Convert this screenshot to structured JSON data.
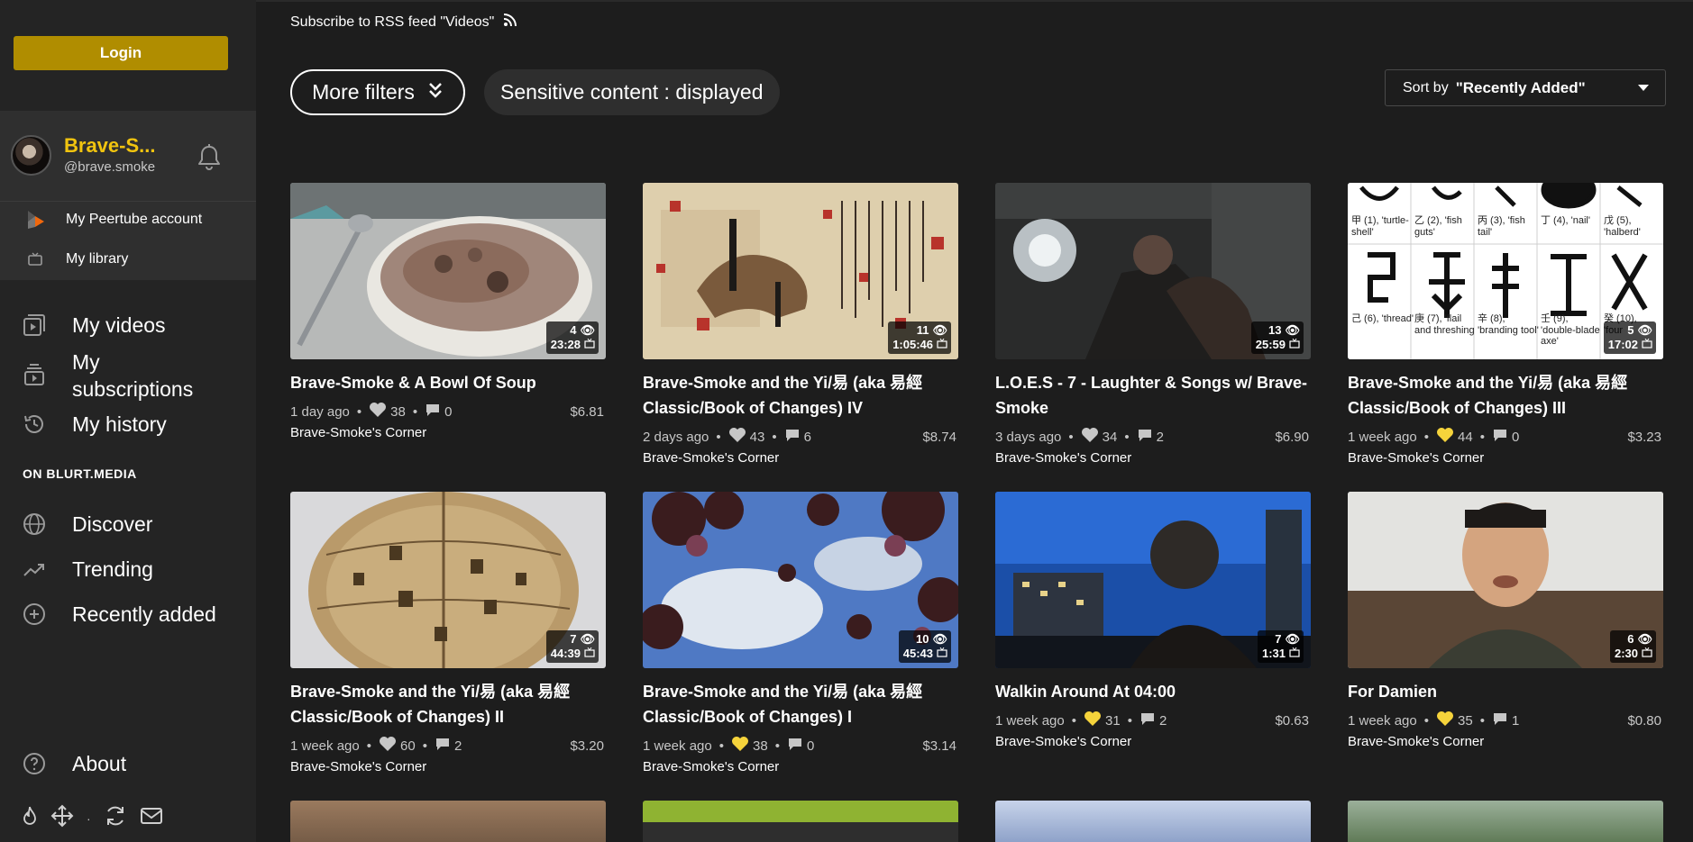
{
  "sidebar": {
    "login_label": "Login",
    "user": {
      "name": "Brave-S...",
      "handle": "@brave.smoke"
    },
    "account_items": [
      {
        "label": "My Peertube account",
        "icon": "peertube-icon"
      },
      {
        "label": "My library",
        "icon": "tv-icon"
      }
    ],
    "library_items": [
      {
        "label": "My videos",
        "icon": "video-library-icon"
      },
      {
        "label": "My\nsubscriptions",
        "icon": "subscriptions-icon"
      },
      {
        "label": "My history",
        "icon": "history-icon"
      }
    ],
    "section_title": "ON BLURT.MEDIA",
    "discover_items": [
      {
        "label": "Discover",
        "icon": "globe-icon"
      },
      {
        "label": "Trending",
        "icon": "trending-icon"
      },
      {
        "label": "Recently added",
        "icon": "plus-circle-icon"
      }
    ],
    "about_label": "About",
    "footer_icons": [
      "fire-icon",
      "move-icon",
      "sync-icon",
      "mail-icon"
    ]
  },
  "header": {
    "rss_label": "Subscribe to RSS feed \"Videos\"",
    "more_filters_label": "More filters",
    "sensitive_label": "Sensitive content : displayed",
    "sort_prefix": "Sort by",
    "sort_value": "\"Recently Added\""
  },
  "colors": {
    "accent": "#b08d00",
    "username": "#f1c40f",
    "like_active": "#f5d33b",
    "like_inactive": "#c7c7c7"
  },
  "videos": [
    {
      "title": "Brave-Smoke & A Bowl Of Soup",
      "views": "4",
      "duration": "23:28",
      "age": "1 day ago",
      "likes": "38",
      "liked": false,
      "comments": "0",
      "price": "$6.81",
      "channel": "Brave-Smoke's Corner",
      "thumb": "soup"
    },
    {
      "title": "Brave-Smoke and the Yi/易 (aka 易經 Classic/Book of Changes) IV",
      "views": "11",
      "duration": "1:05:46",
      "age": "2 days ago",
      "likes": "43",
      "liked": false,
      "comments": "6",
      "price": "$8.74",
      "channel": "Brave-Smoke's Corner",
      "thumb": "scroll"
    },
    {
      "title": "L.O.E.S - 7 - Laughter & Songs w/ Brave-Smoke",
      "views": "13",
      "duration": "25:59",
      "age": "3 days ago",
      "likes": "34",
      "liked": false,
      "comments": "2",
      "price": "$6.90",
      "channel": "Brave-Smoke's Corner",
      "thumb": "kitchen"
    },
    {
      "title": "Brave-Smoke and the Yi/易 (aka 易經 Classic/Book of Changes) III",
      "views": "5",
      "duration": "17:02",
      "age": "1 week ago",
      "likes": "44",
      "liked": true,
      "comments": "0",
      "price": "$3.23",
      "channel": "Brave-Smoke's Corner",
      "thumb": "chars"
    },
    {
      "title": "Brave-Smoke and the Yi/易 (aka 易經 Classic/Book of Changes) II",
      "views": "7",
      "duration": "44:39",
      "age": "1 week ago",
      "likes": "60",
      "liked": false,
      "comments": "2",
      "price": "$3.20",
      "channel": "Brave-Smoke's Corner",
      "thumb": "shell"
    },
    {
      "title": "Brave-Smoke and the Yi/易 (aka 易經 Classic/Book of Changes) I",
      "views": "10",
      "duration": "45:43",
      "age": "1 week ago",
      "likes": "38",
      "liked": true,
      "comments": "0",
      "price": "$3.14",
      "channel": "Brave-Smoke's Corner",
      "thumb": "sky"
    },
    {
      "title": "Walkin Around At 04:00",
      "views": "7",
      "duration": "1:31",
      "age": "1 week ago",
      "likes": "31",
      "liked": true,
      "comments": "2",
      "price": "$0.63",
      "channel": "Brave-Smoke's Corner",
      "thumb": "night"
    },
    {
      "title": "For Damien",
      "views": "6",
      "duration": "2:30",
      "age": "1 week ago",
      "likes": "35",
      "liked": true,
      "comments": "1",
      "price": "$0.80",
      "channel": "Brave-Smoke's Corner",
      "thumb": "couch"
    }
  ],
  "chars_panel": {
    "row1": [
      "甲 (1), 'turtle-shell'",
      "乙 (2), 'fish guts'",
      "丙 (3), 'fish tail'",
      "丁 (4), 'nail'",
      "戊 (5), 'halberd'"
    ],
    "row2": [
      "己 (6), 'thread'",
      "庚 (7), 'flail and threshing",
      "辛 (8), 'branding tool'",
      "壬 (9), 'double-blade axe'",
      "癸 (10), 'four"
    ]
  }
}
